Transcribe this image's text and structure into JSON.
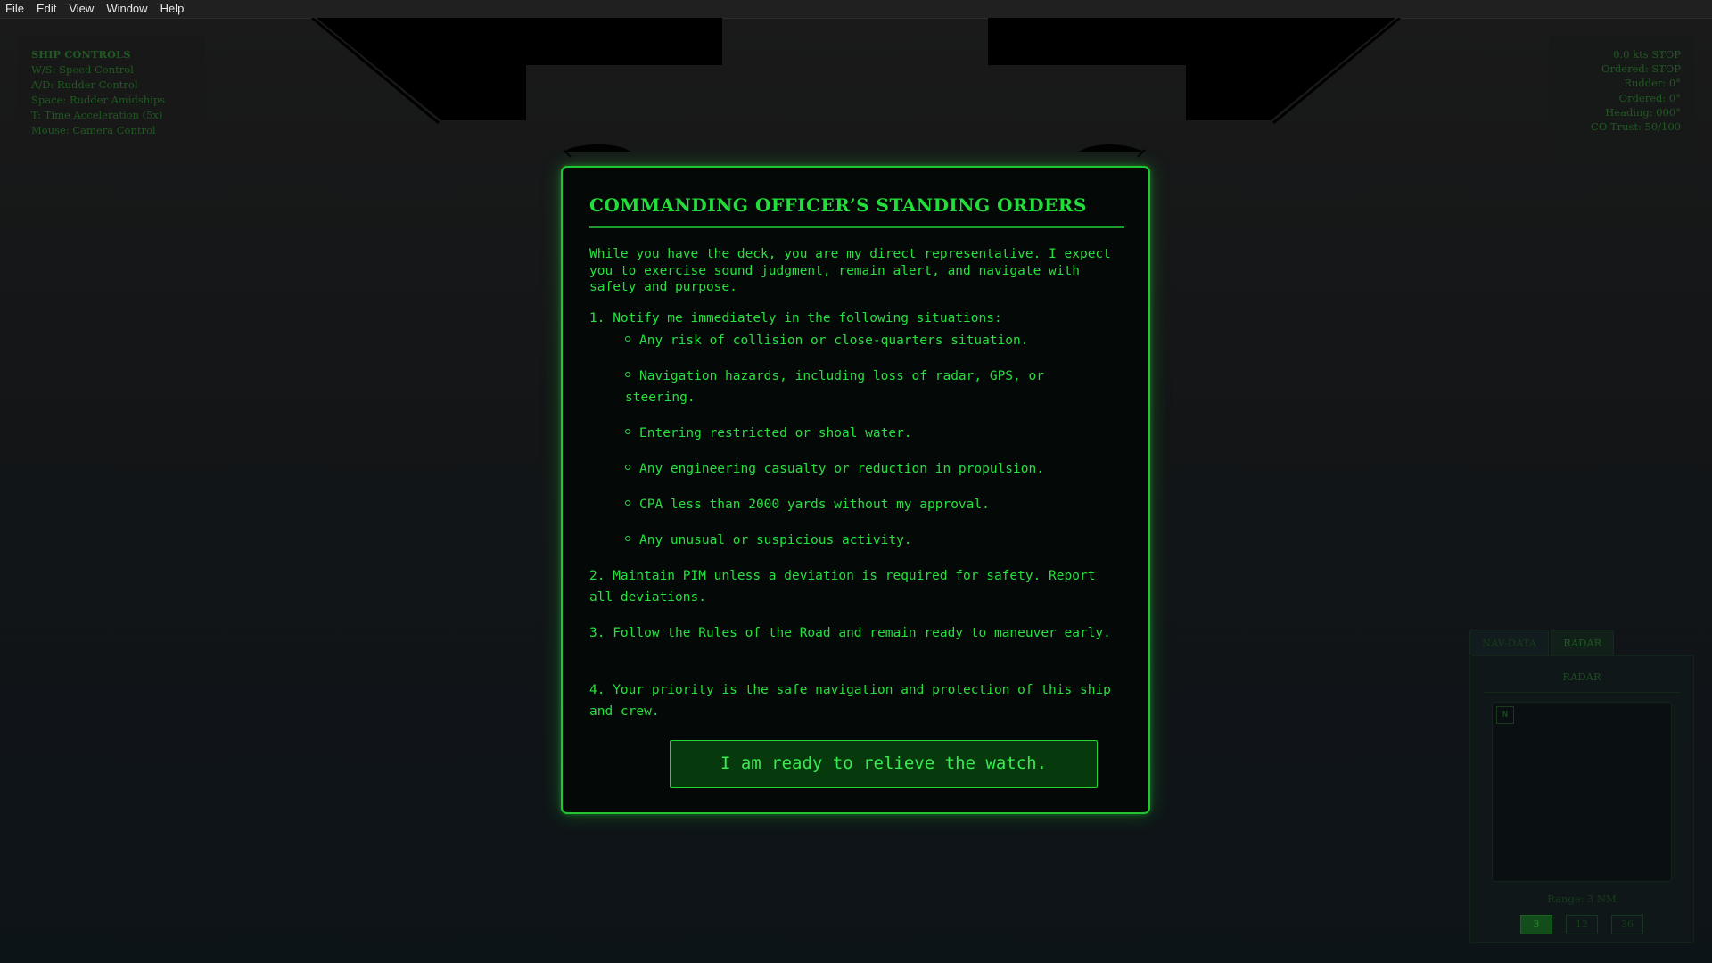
{
  "menu": {
    "items": [
      "File",
      "Edit",
      "View",
      "Window",
      "Help"
    ]
  },
  "controls_panel": {
    "title": "SHIP CONTROLS",
    "lines": [
      "W/S: Speed Control",
      "A/D: Rudder Control",
      "Space: Rudder Amidships",
      "T: Time Acceleration (5x)",
      "Mouse: Camera Control"
    ]
  },
  "status_panel": {
    "lines": [
      "0.0 kts STOP",
      "Ordered: STOP",
      "Rudder: 0°",
      "Ordered: 0°",
      "Heading: 000°",
      "CO Trust: 50/100"
    ]
  },
  "radar": {
    "tabs": [
      "NAV-DATA",
      "RADAR"
    ],
    "title": "RADAR",
    "north": "N",
    "range": "Range: 3 NM",
    "range_buttons": [
      "3",
      "12",
      "36"
    ],
    "active_range": "3"
  },
  "modal": {
    "title": "COMMANDING OFFICER’S STANDING ORDERS",
    "intro": "While you have the deck, you are my direct representative. I expect you to exercise sound judgment, remain alert, and navigate with safety and purpose.",
    "order1": "1. Notify me immediately in the following situations:",
    "bullets": [
      "Any risk of collision or close-quarters situation.",
      "Navigation hazards, including loss of radar, GPS, or steering.",
      "Entering restricted or shoal water.",
      "Any engineering casualty or reduction in propulsion.",
      "CPA less than 2000 yards without my approval.",
      "Any unusual or suspicious activity."
    ],
    "order2": "2. Maintain PIM unless a deviation is required for safety. Report all deviations.",
    "order3": "3. Follow the Rules of the Road and remain ready to maneuver early.",
    "order4": "4. Your priority is the safe navigation and protection of this ship and crew.",
    "button": "I am ready to relieve the watch."
  },
  "colors": {
    "accent": "#22c532",
    "text": "#27e03e",
    "modal_bg": "#040806"
  }
}
